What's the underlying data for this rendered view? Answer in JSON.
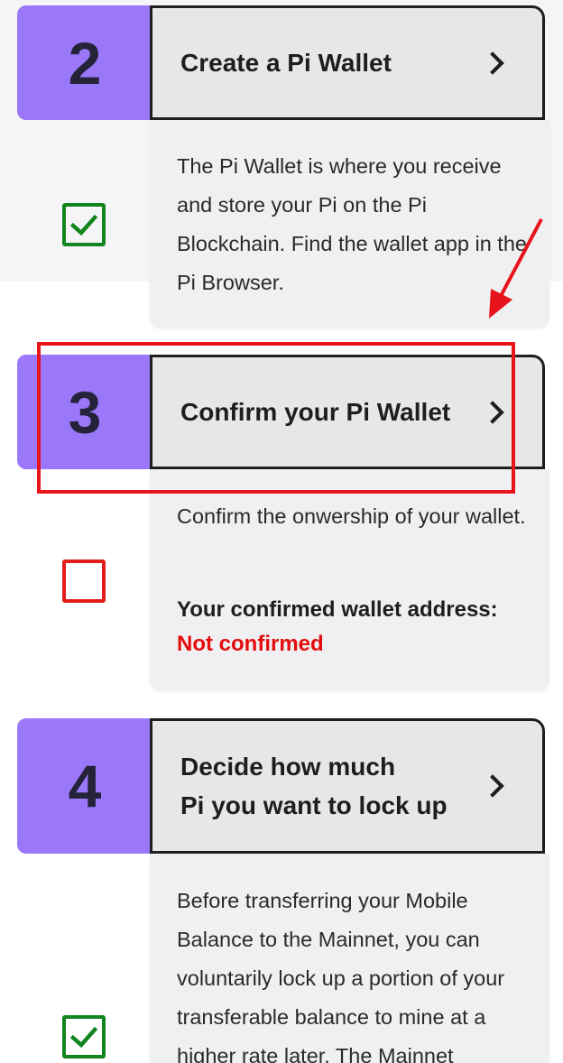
{
  "steps": [
    {
      "number": "2",
      "title": "Create a Pi Wallet",
      "description": "The Pi Wallet is where you receive and store your Pi on the Pi Blockchain. Find the wallet app in the Pi Browser.",
      "status": "checked"
    },
    {
      "number": "3",
      "title": "Confirm your Pi Wallet",
      "description": "Confirm the onwership of your wallet.",
      "address_label": "Your confirmed wallet address:",
      "address_value": "Not confirmed",
      "status": "unchecked"
    },
    {
      "number": "4",
      "title": "Decide how much\nPi you want to lock up",
      "description": "Before transferring your Mobile Balance to the Mainnet, you can voluntarily lock up a portion of your transferable balance to mine at a higher rate later. The Mainnet",
      "status": "checked"
    }
  ],
  "icons": {
    "chevron": "chevron-right-icon",
    "checked": "checkbox-checked-icon",
    "unchecked": "checkbox-empty-icon"
  },
  "colors": {
    "step_number_bg": "#9b78f9",
    "checked": "#12851e",
    "unchecked": "#e41c1c",
    "not_confirmed": "#e40c0c",
    "annotation": "#e8141c"
  }
}
